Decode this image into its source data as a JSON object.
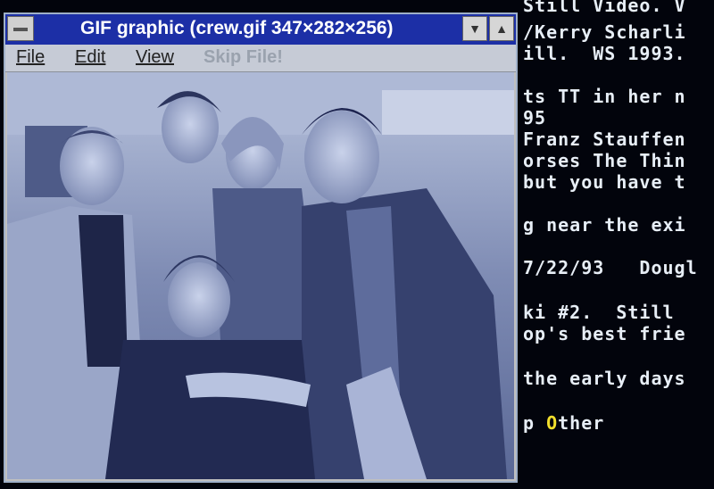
{
  "window": {
    "title": "GIF graphic (crew.gif 347×282×256)",
    "minimize_label": "▼",
    "maximize_label": "▲"
  },
  "menu": {
    "file": "File",
    "edit": "Edit",
    "view": "View",
    "skip": "Skip File!"
  },
  "terminal": {
    "lines": [
      "Still Video. V",
      "/Kerry Scharli",
      "ill.  WS 1993.",
      "ts TT in her n",
      "95",
      "Franz Stauffen",
      "orses The Thin",
      "but you have t",
      "g near the exi",
      "7/22/93   Dougl",
      "ki #2.  Still",
      "op's best frie",
      "the early days"
    ],
    "last_prefix": "p ",
    "last_highlight": "O",
    "last_rest": "ther"
  },
  "image": {
    "filename": "crew.gif",
    "description": "group-photo"
  },
  "colors": {
    "titlebar": "#1c2fa6",
    "terminal_text": "#e7eef6",
    "highlight": "#f2df2c",
    "terminal_bg": "#02040c"
  }
}
